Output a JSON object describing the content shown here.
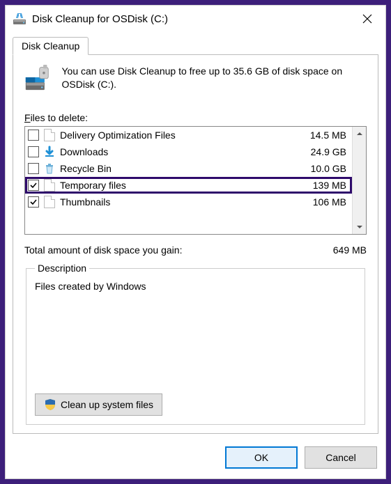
{
  "titlebar": {
    "title": "Disk Cleanup for OSDisk (C:)"
  },
  "tab": {
    "label": "Disk Cleanup"
  },
  "intro": {
    "text": "You can use Disk Cleanup to free up to 35.6 GB of disk space on OSDisk (C:)."
  },
  "files_label_prefix": "F",
  "files_label_rest": "iles to delete:",
  "files": [
    {
      "name": "Delivery Optimization Files",
      "size": "14.5 MB",
      "checked": false,
      "icon": "page",
      "highlighted": false
    },
    {
      "name": "Downloads",
      "size": "24.9 GB",
      "checked": false,
      "icon": "download",
      "highlighted": false
    },
    {
      "name": "Recycle Bin",
      "size": "10.0 GB",
      "checked": false,
      "icon": "recycle",
      "highlighted": false
    },
    {
      "name": "Temporary files",
      "size": "139 MB",
      "checked": true,
      "icon": "page",
      "highlighted": true
    },
    {
      "name": "Thumbnails",
      "size": "106 MB",
      "checked": true,
      "icon": "page",
      "highlighted": false
    }
  ],
  "total": {
    "label": "Total amount of disk space you gain:",
    "value": "649 MB"
  },
  "description": {
    "legend": "Description",
    "text": "Files created by Windows"
  },
  "cleanup_button": "Clean up system files",
  "footer": {
    "ok": "OK",
    "cancel": "Cancel"
  }
}
